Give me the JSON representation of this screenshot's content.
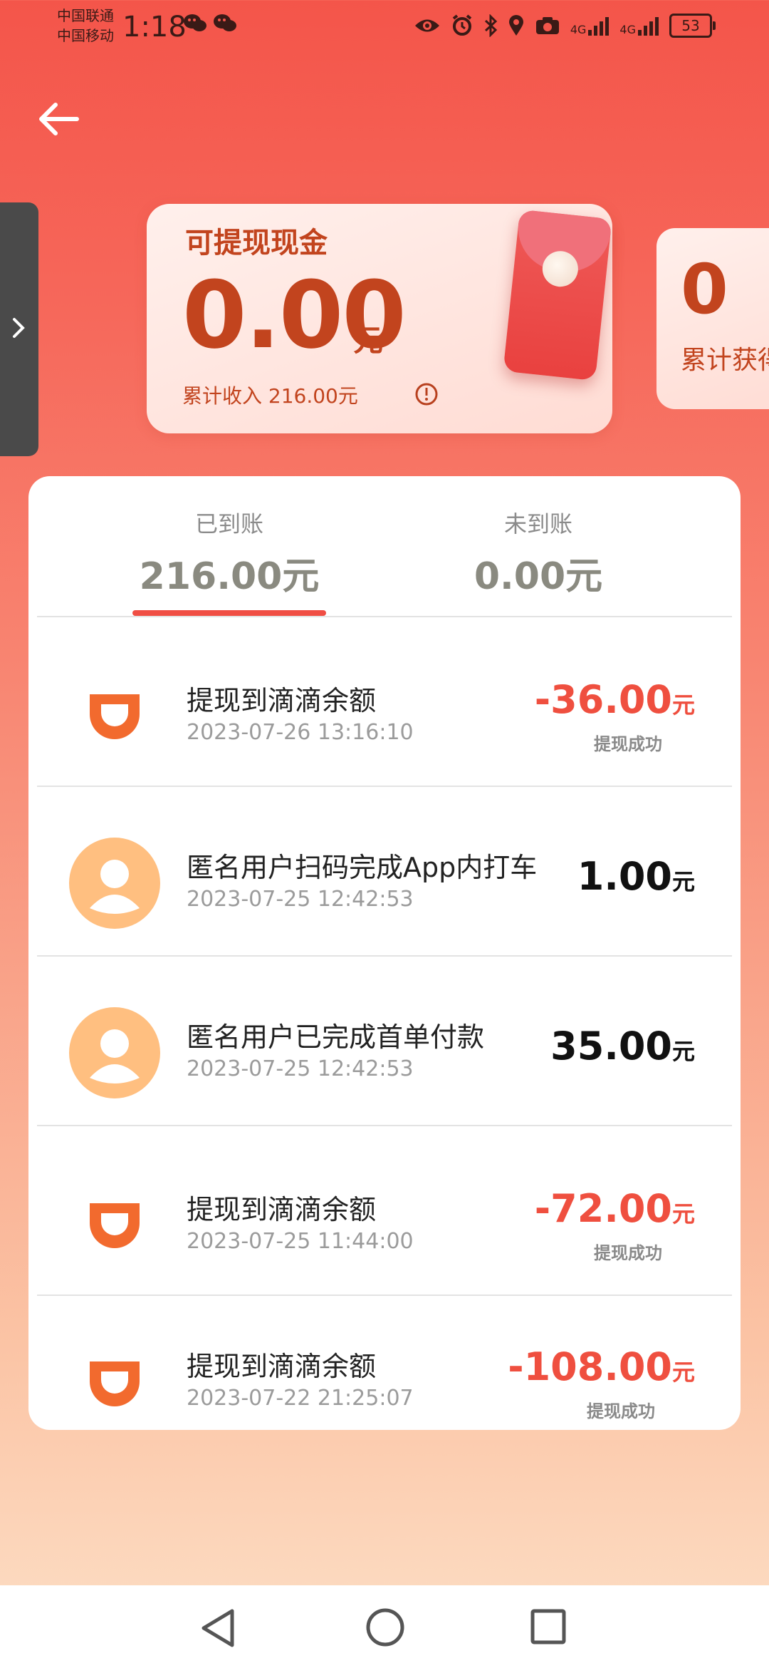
{
  "status_bar": {
    "carrier1": "中国联通",
    "carrier2": "中国移动",
    "time": "1:18",
    "net1": "4G",
    "net2": "4G",
    "battery": "53"
  },
  "cash_card": {
    "title": "可提现现金",
    "amount": "0.00",
    "unit": "元",
    "subtitle": "累计收入 216.00元"
  },
  "second_card": {
    "value": "0",
    "label": "累计获得"
  },
  "tabs": [
    {
      "label": "已到账",
      "value": "216.00元"
    },
    {
      "label": "未到账",
      "value": "0.00元"
    }
  ],
  "records": [
    {
      "type": "didi",
      "title": "提现到滴滴余额",
      "date": "2023-07-26 13:16:10",
      "amount": "-36.00",
      "unit": "元",
      "status": "提现成功"
    },
    {
      "type": "user",
      "title": "匿名用户扫码完成App内打车",
      "date": "2023-07-25 12:42:53",
      "amount": "1.00",
      "unit": "元",
      "status": ""
    },
    {
      "type": "user",
      "title": "匿名用户已完成首单付款",
      "date": "2023-07-25 12:42:53",
      "amount": "35.00",
      "unit": "元",
      "status": ""
    },
    {
      "type": "didi",
      "title": "提现到滴滴余额",
      "date": "2023-07-25 11:44:00",
      "amount": "-72.00",
      "unit": "元",
      "status": "提现成功"
    },
    {
      "type": "didi",
      "title": "提现到滴滴余额",
      "date": "2023-07-22 21:25:07",
      "amount": "-108.00",
      "unit": "元",
      "status": "提现成功"
    }
  ],
  "colors": {
    "accent": "#ef4f3f",
    "brand_orange": "#f26a2e",
    "avatar": "#ffbf80"
  }
}
